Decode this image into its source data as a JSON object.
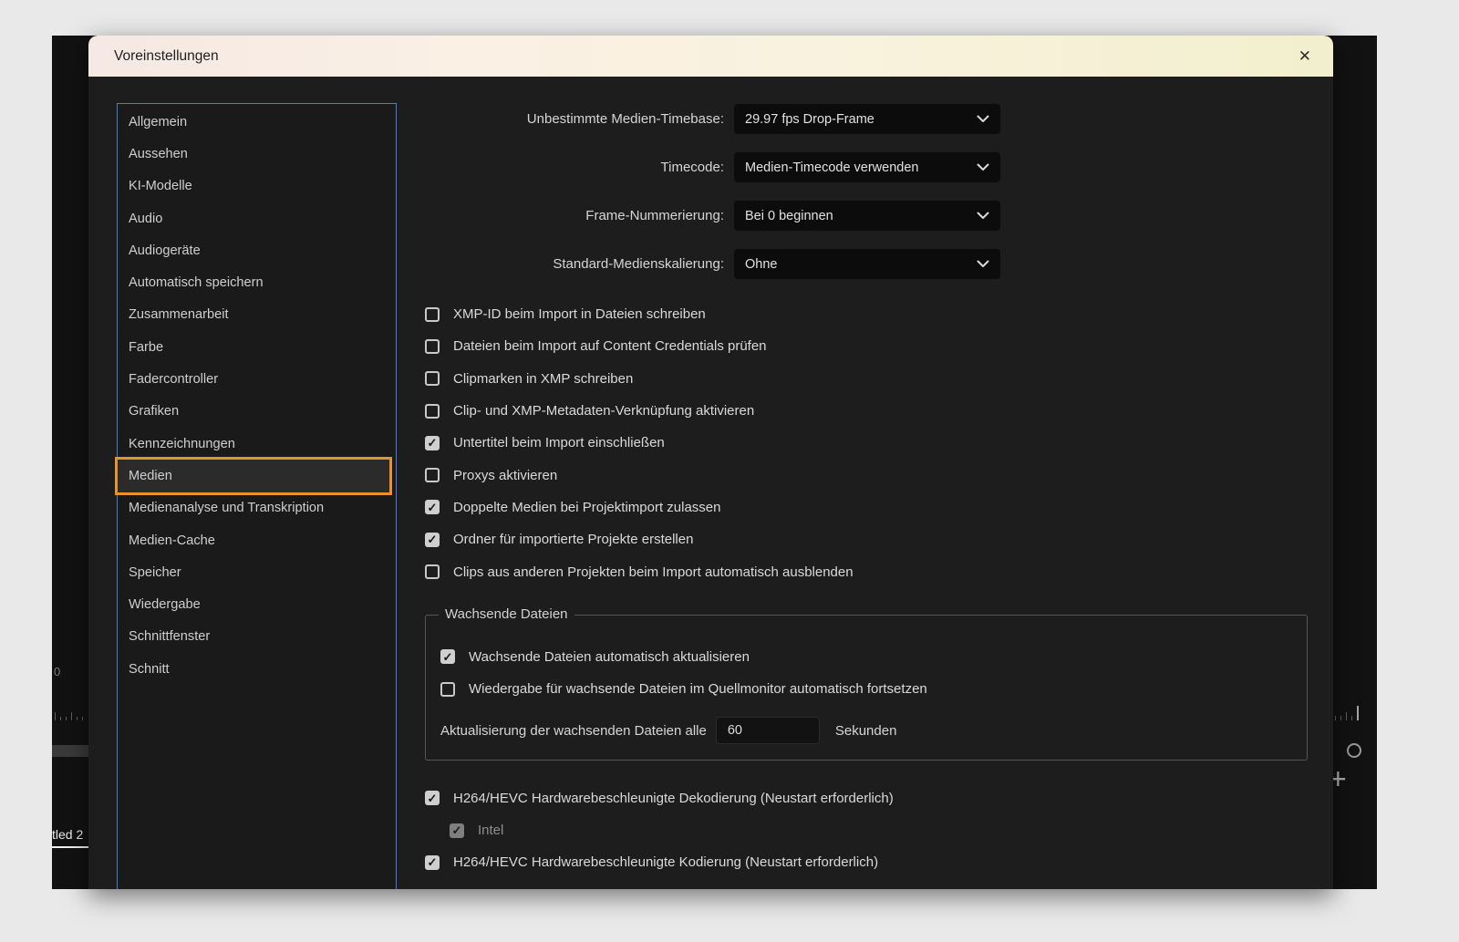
{
  "dialog": {
    "title": "Voreinstellungen",
    "close_icon": "✕"
  },
  "sidebar": {
    "items": [
      {
        "label": "Allgemein"
      },
      {
        "label": "Aussehen"
      },
      {
        "label": "KI-Modelle"
      },
      {
        "label": "Audio"
      },
      {
        "label": "Audiogeräte"
      },
      {
        "label": "Automatisch speichern"
      },
      {
        "label": "Zusammenarbeit"
      },
      {
        "label": "Farbe"
      },
      {
        "label": "Fadercontroller"
      },
      {
        "label": "Grafiken"
      },
      {
        "label": "Kennzeichnungen"
      },
      {
        "label": "Medien",
        "selected": true
      },
      {
        "label": "Medienanalyse und Transkription"
      },
      {
        "label": "Medien-Cache"
      },
      {
        "label": "Speicher"
      },
      {
        "label": "Wiedergabe"
      },
      {
        "label": "Schnittfenster"
      },
      {
        "label": "Schnitt"
      }
    ]
  },
  "dropdowns": [
    {
      "label": "Unbestimmte Medien-Timebase:",
      "value": "29.97 fps Drop-Frame"
    },
    {
      "label": "Timecode:",
      "value": "Medien-Timecode verwenden"
    },
    {
      "label": "Frame-Nummerierung:",
      "value": "Bei 0 beginnen"
    },
    {
      "label": "Standard-Medienskalierung:",
      "value": "Ohne"
    }
  ],
  "media_options": [
    {
      "label": "XMP-ID beim Import in Dateien schreiben",
      "checked": false
    },
    {
      "label": "Dateien beim Import auf Content Credentials prüfen",
      "checked": false
    },
    {
      "label": "Clipmarken in XMP schreiben",
      "checked": false
    },
    {
      "label": "Clip- und XMP-Metadaten-Verknüpfung aktivieren",
      "checked": false
    },
    {
      "label": "Untertitel beim Import einschließen",
      "checked": true
    },
    {
      "label": "Proxys aktivieren",
      "checked": false
    },
    {
      "label": "Doppelte Medien bei Projektimport zulassen",
      "checked": true
    },
    {
      "label": "Ordner für importierte Projekte erstellen",
      "checked": true
    },
    {
      "label": "Clips aus anderen Projekten beim Import automatisch ausblenden",
      "checked": false
    }
  ],
  "growing_files": {
    "title": "Wachsende Dateien",
    "options": [
      {
        "label": "Wachsende Dateien automatisch aktualisieren",
        "checked": true
      },
      {
        "label": "Wiedergabe für wachsende Dateien im Quellmonitor automatisch fortsetzen",
        "checked": false
      }
    ],
    "interval_label": "Aktualisierung der wachsenden Dateien alle",
    "interval_value": "60",
    "interval_unit": "Sekunden"
  },
  "hardware_options": [
    {
      "label": "H264/HEVC Hardwarebeschleunigte Dekodierung (Neustart erforderlich)",
      "checked": true
    },
    {
      "label": "Intel",
      "checked": true,
      "disabled": true
    },
    {
      "label": "H264/HEVC Hardwarebeschleunigte Kodierung (Neustart erforderlich)",
      "checked": true
    }
  ],
  "background_app": {
    "ruler_value": "0",
    "timeline_tab_label": "tled 2",
    "plus_icon": "+"
  },
  "colors": {
    "accent_orange": "#e8912e",
    "sidebar_border_blue": "#3f7fd4",
    "dialog_bg": "#1d1d1d",
    "titlebar_gradient_left": "#f6e8e3",
    "titlebar_gradient_right": "#f2efce"
  }
}
